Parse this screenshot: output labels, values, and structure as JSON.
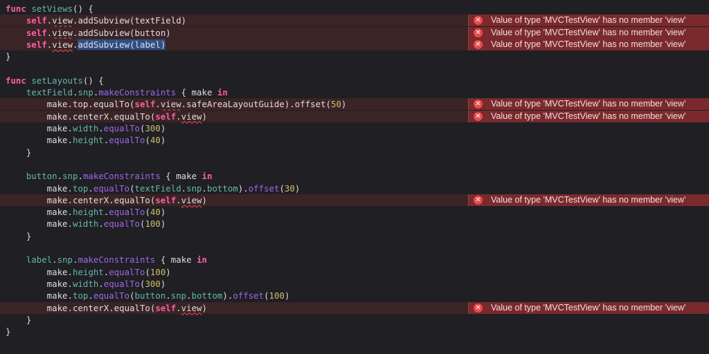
{
  "editor": {
    "lines": [
      {
        "parts": [
          [
            "func",
            "kw"
          ],
          [
            " ",
            ""
          ],
          [
            "setViews",
            "fn"
          ],
          [
            "() {",
            ""
          ]
        ]
      },
      {
        "parts": [
          [
            "    ",
            ""
          ],
          [
            "self",
            "kw"
          ],
          [
            ".",
            ""
          ],
          [
            "view",
            "squig"
          ],
          [
            ".addSubview(textField)",
            ""
          ]
        ],
        "error": true
      },
      {
        "parts": [
          [
            "    ",
            ""
          ],
          [
            "self",
            "kw"
          ],
          [
            ".",
            ""
          ],
          [
            "view",
            "squig"
          ],
          [
            ".addSubview(button)",
            ""
          ]
        ],
        "error": true
      },
      {
        "parts": [
          [
            "    ",
            ""
          ],
          [
            "self",
            "kw"
          ],
          [
            ".",
            ""
          ],
          [
            "view",
            "squig"
          ],
          [
            ".",
            ""
          ],
          [
            "addSubview(label)",
            "sel"
          ]
        ],
        "error": true
      },
      {
        "parts": [
          [
            "}",
            ""
          ]
        ]
      },
      {
        "parts": []
      },
      {
        "parts": [
          [
            "func",
            "kw"
          ],
          [
            " ",
            ""
          ],
          [
            "setLayouts",
            "fn"
          ],
          [
            "() {",
            ""
          ]
        ]
      },
      {
        "parts": [
          [
            "    ",
            ""
          ],
          [
            "textField",
            "mem"
          ],
          [
            ".",
            ""
          ],
          [
            "snp",
            "mem"
          ],
          [
            ".",
            ""
          ],
          [
            "makeConstraints",
            "cl"
          ],
          [
            " { make ",
            ""
          ],
          [
            "in",
            "kw"
          ]
        ]
      },
      {
        "parts": [
          [
            "        make.top.equalTo(",
            ""
          ],
          [
            "self",
            "kw"
          ],
          [
            ".",
            ""
          ],
          [
            "view",
            "squig"
          ],
          [
            ".safeAreaLayoutGuide).offset(",
            ""
          ],
          [
            "50",
            "num"
          ],
          [
            ")",
            ""
          ]
        ],
        "error": true
      },
      {
        "parts": [
          [
            "        make.centerX.equalTo(",
            ""
          ],
          [
            "self",
            "kw"
          ],
          [
            ".",
            ""
          ],
          [
            "view",
            "squig"
          ],
          [
            ")",
            ""
          ]
        ],
        "error": true
      },
      {
        "parts": [
          [
            "        make.",
            ""
          ],
          [
            "width",
            "mem"
          ],
          [
            ".",
            ""
          ],
          [
            "equalTo",
            "cl"
          ],
          [
            "(",
            ""
          ],
          [
            "300",
            "num"
          ],
          [
            ")",
            ""
          ]
        ]
      },
      {
        "parts": [
          [
            "        make.",
            ""
          ],
          [
            "height",
            "mem"
          ],
          [
            ".",
            ""
          ],
          [
            "equalTo",
            "cl"
          ],
          [
            "(",
            ""
          ],
          [
            "40",
            "num"
          ],
          [
            ")",
            ""
          ]
        ]
      },
      {
        "parts": [
          [
            "    }",
            ""
          ]
        ]
      },
      {
        "parts": []
      },
      {
        "parts": [
          [
            "    ",
            ""
          ],
          [
            "button",
            "mem"
          ],
          [
            ".",
            ""
          ],
          [
            "snp",
            "mem"
          ],
          [
            ".",
            ""
          ],
          [
            "makeConstraints",
            "cl"
          ],
          [
            " { make ",
            ""
          ],
          [
            "in",
            "kw"
          ]
        ]
      },
      {
        "parts": [
          [
            "        make.",
            ""
          ],
          [
            "top",
            "mem"
          ],
          [
            ".",
            ""
          ],
          [
            "equalTo",
            "cl"
          ],
          [
            "(",
            ""
          ],
          [
            "textField",
            "mem"
          ],
          [
            ".",
            ""
          ],
          [
            "snp",
            "mem"
          ],
          [
            ".",
            ""
          ],
          [
            "bottom",
            "mem"
          ],
          [
            ").",
            ""
          ],
          [
            "offset",
            "cl"
          ],
          [
            "(",
            ""
          ],
          [
            "30",
            "num"
          ],
          [
            ")",
            ""
          ]
        ]
      },
      {
        "parts": [
          [
            "        make.centerX.equalTo(",
            ""
          ],
          [
            "self",
            "kw"
          ],
          [
            ".",
            ""
          ],
          [
            "view",
            "squig"
          ],
          [
            ")",
            ""
          ]
        ],
        "error": true
      },
      {
        "parts": [
          [
            "        make.",
            ""
          ],
          [
            "height",
            "mem"
          ],
          [
            ".",
            ""
          ],
          [
            "equalTo",
            "cl"
          ],
          [
            "(",
            ""
          ],
          [
            "40",
            "num"
          ],
          [
            ")",
            ""
          ]
        ]
      },
      {
        "parts": [
          [
            "        make.",
            ""
          ],
          [
            "width",
            "mem"
          ],
          [
            ".",
            ""
          ],
          [
            "equalTo",
            "cl"
          ],
          [
            "(",
            ""
          ],
          [
            "100",
            "num"
          ],
          [
            ")",
            ""
          ]
        ]
      },
      {
        "parts": [
          [
            "    }",
            ""
          ]
        ]
      },
      {
        "parts": []
      },
      {
        "parts": [
          [
            "    ",
            ""
          ],
          [
            "label",
            "mem"
          ],
          [
            ".",
            ""
          ],
          [
            "snp",
            "mem"
          ],
          [
            ".",
            ""
          ],
          [
            "makeConstraints",
            "cl"
          ],
          [
            " { make ",
            ""
          ],
          [
            "in",
            "kw"
          ]
        ]
      },
      {
        "parts": [
          [
            "        make.",
            ""
          ],
          [
            "height",
            "mem"
          ],
          [
            ".",
            ""
          ],
          [
            "equalTo",
            "cl"
          ],
          [
            "(",
            ""
          ],
          [
            "100",
            "num"
          ],
          [
            ")",
            ""
          ]
        ]
      },
      {
        "parts": [
          [
            "        make.",
            ""
          ],
          [
            "width",
            "mem"
          ],
          [
            ".",
            ""
          ],
          [
            "equalTo",
            "cl"
          ],
          [
            "(",
            ""
          ],
          [
            "300",
            "num"
          ],
          [
            ")",
            ""
          ]
        ]
      },
      {
        "parts": [
          [
            "        make.",
            ""
          ],
          [
            "top",
            "mem"
          ],
          [
            ".",
            ""
          ],
          [
            "equalTo",
            "cl"
          ],
          [
            "(",
            ""
          ],
          [
            "button",
            "mem"
          ],
          [
            ".",
            ""
          ],
          [
            "snp",
            "mem"
          ],
          [
            ".",
            ""
          ],
          [
            "bottom",
            "mem"
          ],
          [
            ").",
            ""
          ],
          [
            "offset",
            "cl"
          ],
          [
            "(",
            ""
          ],
          [
            "100",
            "num"
          ],
          [
            ")",
            ""
          ]
        ]
      },
      {
        "parts": [
          [
            "        make.centerX.equalTo(",
            ""
          ],
          [
            "self",
            "kw"
          ],
          [
            ".",
            ""
          ],
          [
            "view",
            "squig"
          ],
          [
            ")",
            ""
          ]
        ],
        "error": true
      },
      {
        "parts": [
          [
            "    }",
            ""
          ]
        ]
      },
      {
        "parts": [
          [
            "}",
            ""
          ]
        ]
      }
    ],
    "error_message": "Value of type 'MVCTestView' has no member 'view'",
    "error_icon": "error-x-icon",
    "error_glyph": "✕"
  },
  "colors": {
    "background": "#1f1f24",
    "keyword": "#fc5fa3",
    "number": "#d0bf69",
    "error_badge": "#7a2a2d"
  }
}
